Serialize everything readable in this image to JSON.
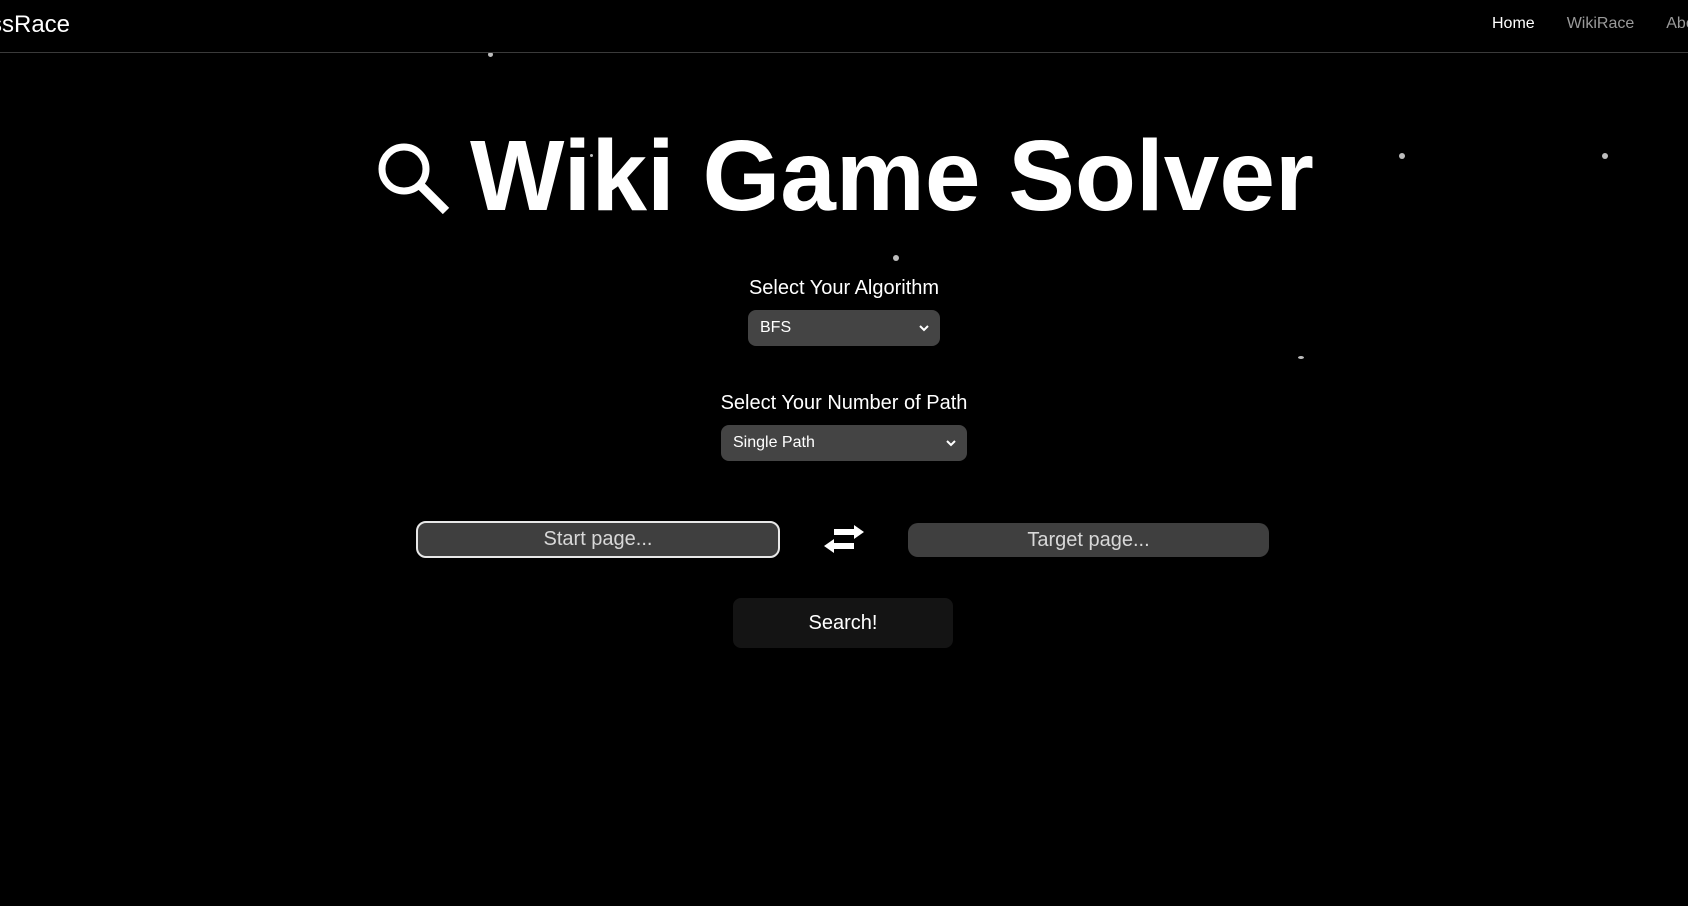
{
  "navbar": {
    "brand": "ssRace",
    "links": [
      {
        "label": "Home",
        "active": true
      },
      {
        "label": "WikiRace",
        "active": false
      },
      {
        "label": "Abo",
        "active": false
      }
    ]
  },
  "hero": {
    "title": "Wiki Game Solver",
    "icon": "search-icon"
  },
  "algorithm": {
    "label": "Select Your Algorithm",
    "selected": "BFS"
  },
  "path_count": {
    "label": "Select Your Number of Path",
    "selected": "Single Path"
  },
  "inputs": {
    "start_placeholder": "Start page...",
    "target_placeholder": "Target page...",
    "swap_icon": "swap-arrows-icon"
  },
  "search": {
    "label": "Search!"
  },
  "colors": {
    "background": "#000000",
    "field": "#444444",
    "button": "#141414",
    "nav_inactive": "#9a9a9a"
  }
}
